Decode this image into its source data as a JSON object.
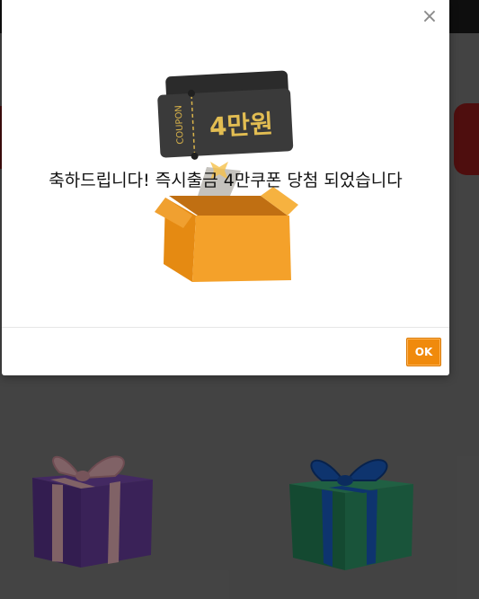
{
  "page": {
    "background_color": "#7b7b7b",
    "overlay_color": "rgba(0,0,0,0.45)"
  },
  "background": {
    "gifts": [
      {
        "name": "purple-gift",
        "box_color": "#6b3fa0",
        "ribbon_color": "#f0b8c0"
      },
      {
        "name": "green-gift",
        "box_color": "#2f9a6a",
        "ribbon_color": "#1a5fc8"
      }
    ]
  },
  "modal": {
    "close_icon": "close-icon",
    "close_label": "×",
    "coupon_label": "COUPON",
    "coupon_amount": "4만원",
    "message": "축하드립니다! 즉시출금 4만쿠폰 당첨 되었습니다",
    "ok_label": "OK",
    "accent_color": "#f08a0c"
  }
}
